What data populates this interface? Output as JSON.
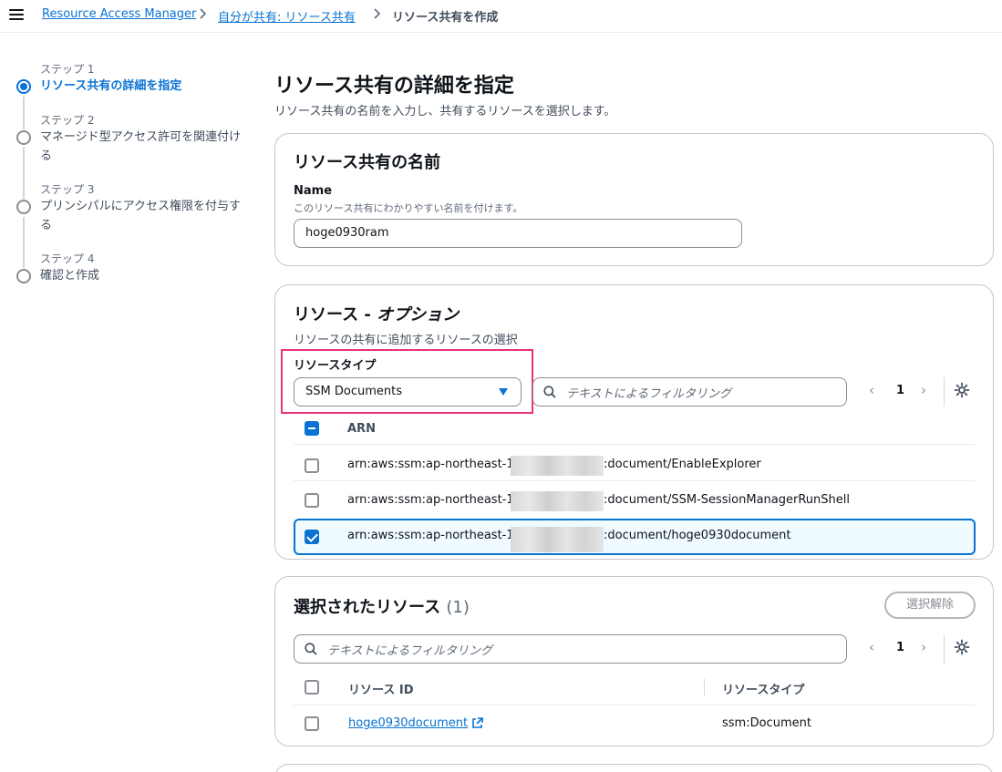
{
  "breadcrumb": {
    "items": [
      "Resource Access Manager",
      "自分が共有: リソース共有"
    ],
    "current": "リソース共有を作成"
  },
  "steps": [
    {
      "label": "ステップ 1",
      "title": "リソース共有の詳細を指定",
      "active": true
    },
    {
      "label": "ステップ 2",
      "title": "マネージド型アクセス許可を関連付ける",
      "active": false
    },
    {
      "label": "ステップ 3",
      "title": "プリンシパルにアクセス権限を付与する",
      "active": false
    },
    {
      "label": "ステップ 4",
      "title": "確認と作成",
      "active": false
    }
  ],
  "main": {
    "title": "リソース共有の詳細を指定",
    "description": "リソース共有の名前を入力し、共有するリソースを選択します。"
  },
  "name_panel": {
    "title": "リソース共有の名前",
    "field_label": "Name",
    "field_desc": "このリソース共有にわかりやすい名前を付けます。",
    "value": "hoge0930ram"
  },
  "resources_panel": {
    "title_main": "リソース - ",
    "title_italic": "オプション",
    "description": "リソースの共有に追加するリソースの選択",
    "type_label": "リソースタイプ",
    "type_value": "SSM Documents",
    "filter_placeholder": "テキストによるフィルタリング",
    "page": "1",
    "column_arn": "ARN",
    "rows": [
      {
        "prefix": "arn:aws:ssm:ap-northeast-1",
        "suffix": ":document/EnableExplorer",
        "checked": false
      },
      {
        "prefix": "arn:aws:ssm:ap-northeast-1",
        "suffix": ":document/SSM-SessionManagerRunShell",
        "checked": false
      },
      {
        "prefix": "arn:aws:ssm:ap-northeast-1",
        "suffix": ":document/hoge0930document",
        "checked": true
      }
    ]
  },
  "selected_panel": {
    "title": "選択されたリソース",
    "count": "(1)",
    "deselect_button": "選択解除",
    "filter_placeholder": "テキストによるフィルタリング",
    "page": "1",
    "col_id": "リソース ID",
    "col_type": "リソースタイプ",
    "rows": [
      {
        "id": "hoge0930document",
        "type": "ssm:Document"
      }
    ]
  },
  "colors": {
    "accent": "#0972d3",
    "highlight": "#e8337a"
  }
}
